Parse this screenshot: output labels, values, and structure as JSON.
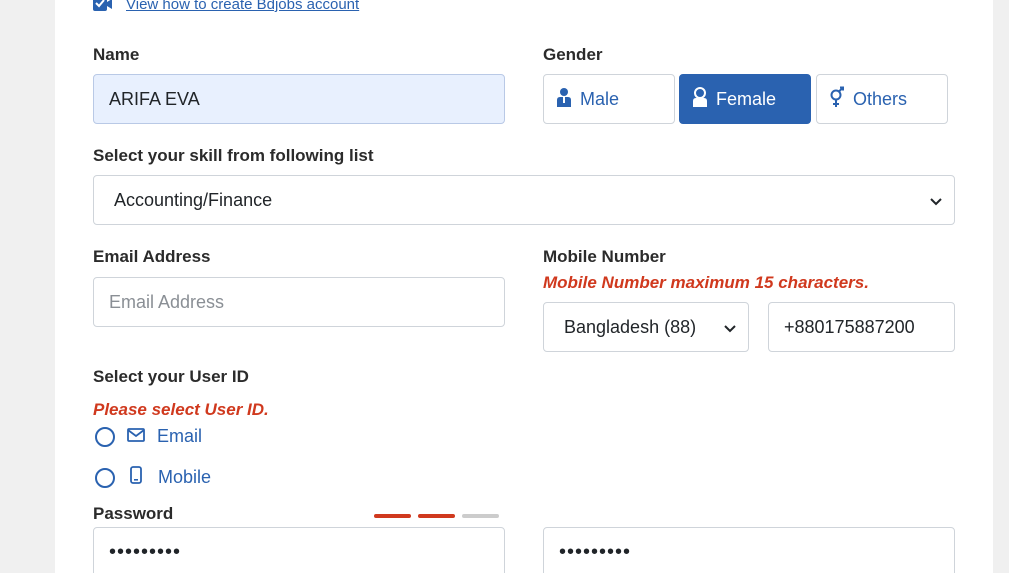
{
  "top_link": {
    "text": "View how to create Bdjobs account"
  },
  "name": {
    "label": "Name",
    "value": "ARIFA EVA"
  },
  "gender": {
    "label": "Gender",
    "options": [
      {
        "label": "Male",
        "icon": "male-icon",
        "selected": false
      },
      {
        "label": "Female",
        "icon": "female-icon",
        "selected": true
      },
      {
        "label": "Others",
        "icon": "others-icon",
        "selected": false
      }
    ]
  },
  "skill": {
    "label": "Select your skill from following list",
    "value": "Accounting/Finance"
  },
  "email": {
    "label": "Email Address",
    "placeholder": "Email Address"
  },
  "mobile": {
    "label": "Mobile Number",
    "error": "Mobile Number maximum 15 characters.",
    "country": "Bangladesh (88)",
    "value": "+880175887200"
  },
  "user_id": {
    "label": "Select your User ID",
    "error": "Please select User ID.",
    "options": [
      {
        "label": "Email",
        "icon": "envelope-icon"
      },
      {
        "label": "Mobile",
        "icon": "phone-icon"
      }
    ]
  },
  "password": {
    "label": "Password",
    "value": "•••••••••",
    "strength_segments": 2,
    "confirm_value": "•••••••••"
  },
  "colors": {
    "accent": "#2a62b0",
    "error": "#d0391e",
    "strength_active": "#d0391e",
    "strength_inactive": "#cccccc"
  }
}
